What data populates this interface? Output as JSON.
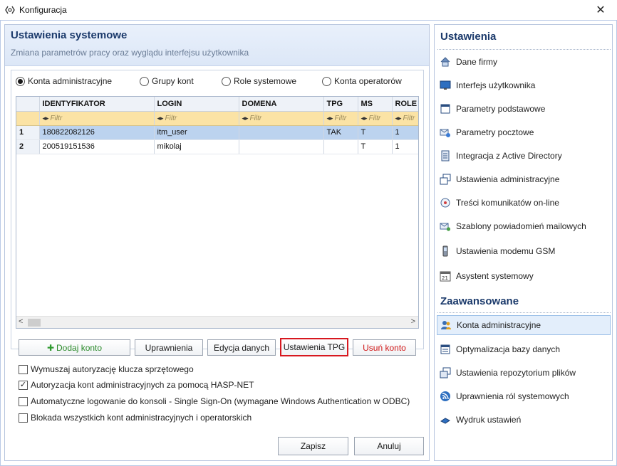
{
  "window": {
    "title": "Konfiguracja",
    "close_glyph": "✕"
  },
  "main": {
    "title": "Ustawienia systemowe",
    "subtitle": "Zmiana parametrów pracy oraz wyglądu interfejsu użytkownika"
  },
  "radios": [
    {
      "label": "Konta administracyjne",
      "selected": true
    },
    {
      "label": "Grupy kont",
      "selected": false
    },
    {
      "label": "Role systemowe",
      "selected": false
    },
    {
      "label": "Konta operatorów",
      "selected": false
    }
  ],
  "grid": {
    "columns": [
      "IDENTYFIKATOR",
      "LOGIN",
      "DOMENA",
      "TPG",
      "MS",
      "ROLE"
    ],
    "filter_arrows": "◂▸",
    "filter_placeholder": "Filtr",
    "rows": [
      {
        "num": "1",
        "cells": [
          "180822082126",
          "itm_user",
          "",
          "TAK",
          "T",
          "1"
        ],
        "selected": true
      },
      {
        "num": "2",
        "cells": [
          "200519151536",
          "mikolaj",
          "",
          "",
          "T",
          "1"
        ],
        "selected": false
      }
    ],
    "scroll_left": "<",
    "scroll_right": ">"
  },
  "buttons": {
    "add_icon": "✚",
    "add": "Dodaj konto",
    "permissions": "Uprawnienia",
    "edit": "Edycja danych",
    "tpg": "Ustawienia TPG",
    "delete": "Usuń konto"
  },
  "checks": [
    {
      "label": "Wymuszaj autoryzację klucza sprzętowego",
      "checked": false
    },
    {
      "label": "Autoryzacja kont administracyjnych za pomocą HASP-NET",
      "checked": true
    },
    {
      "label": "Automatyczne logowanie do konsoli - Single Sign-On (wymagane Windows Authentication w ODBC)",
      "checked": false
    },
    {
      "label": "Blokada wszystkich kont administracyjnych i operatorskich",
      "checked": false
    }
  ],
  "footer": {
    "save": "Zapisz",
    "cancel": "Anuluj"
  },
  "side": {
    "heading_settings": "Ustawienia",
    "items_settings": [
      {
        "label": "Dane firmy",
        "icon": "house-icon"
      },
      {
        "label": "Interfejs użytkownika",
        "icon": "monitor-icon"
      },
      {
        "label": "Parametry podstawowe",
        "icon": "window-icon"
      },
      {
        "label": "Parametry pocztowe",
        "icon": "mail-settings-icon"
      },
      {
        "label": "Integracja z Active Directory",
        "icon": "directory-icon"
      },
      {
        "label": "Ustawienia administracyjne",
        "icon": "admin-windows-icon"
      },
      {
        "label": "Treści komunikatów on-line",
        "icon": "message-icon"
      },
      {
        "label": "Szablony powiadomień mailowych",
        "icon": "mail-template-icon"
      },
      {
        "label": "Ustawienia modemu GSM",
        "icon": "phone-icon"
      },
      {
        "label": "Asystent systemowy",
        "icon": "calendar-icon"
      }
    ],
    "heading_advanced": "Zaawansowane",
    "items_advanced": [
      {
        "label": "Konta administracyjne",
        "icon": "users-icon",
        "active": true
      },
      {
        "label": "Optymalizacja bazy danych",
        "icon": "database-icon",
        "active": false
      },
      {
        "label": "Ustawienia repozytorium plików",
        "icon": "repository-icon",
        "active": false
      },
      {
        "label": "Uprawnienia ról systemowych",
        "icon": "rss-icon",
        "active": false
      },
      {
        "label": "Wydruk ustawień",
        "icon": "print-icon",
        "active": false
      }
    ]
  },
  "colors": {
    "accent_title": "#1b3a6b",
    "selected_row": "#bcd3ef",
    "filter_row": "#fbe3a5",
    "tpg_highlight": "#d7181f",
    "delete_text": "#d01616",
    "add_text": "#2a8a2a"
  }
}
